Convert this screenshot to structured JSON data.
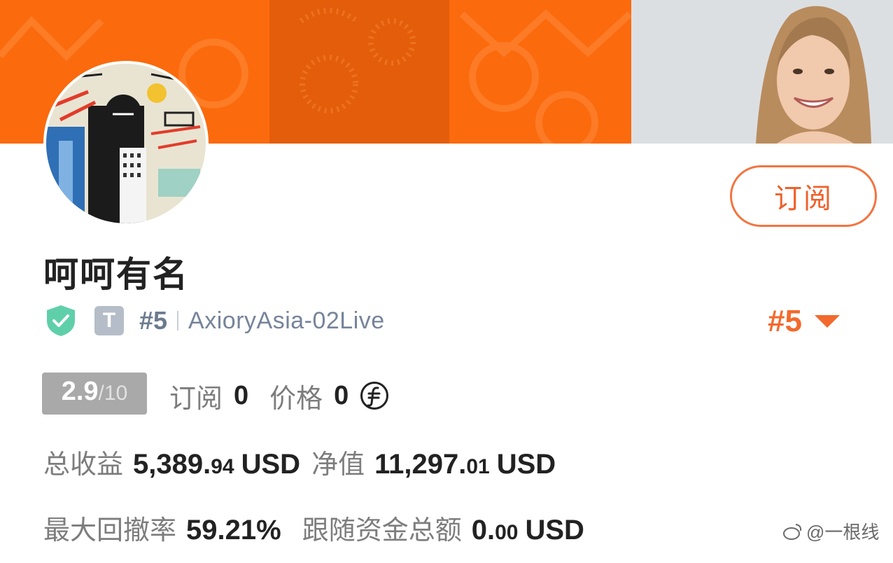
{
  "profile": {
    "name": "呵呵有名",
    "subscribe_label": "订阅",
    "rank_tag": "#5",
    "account": "AxioryAsia-02Live",
    "rank_select": "#5",
    "t_badge": "T"
  },
  "stats": {
    "score_main": "2.9",
    "score_sub": "/10",
    "subscribe_label": "订阅",
    "subscribe_count": "0",
    "price_label": "价格",
    "price_value": "0"
  },
  "finance": {
    "total_profit_label": "总收益",
    "total_profit_int": "5,389.",
    "total_profit_dec": "94",
    "total_profit_unit": "USD",
    "equity_label": "净值",
    "equity_int": "11,297.",
    "equity_dec": "01",
    "equity_unit": "USD",
    "drawdown_label": "最大回撤率",
    "drawdown_value": "59.21%",
    "follow_label": "跟随资金总额",
    "follow_int": "0.",
    "follow_dec": "00",
    "follow_unit": "USD"
  },
  "watermark": "@一根线",
  "colors": {
    "accent": "#f26a2c",
    "banner_orange": "#fb6a0c",
    "banner_dark": "#e45d0a",
    "shield": "#5fcfaa",
    "score_bg": "#a9a9a9"
  },
  "icons": [
    "shield-check-icon",
    "coin-f-icon",
    "caret-down-icon",
    "weibo-icon"
  ]
}
